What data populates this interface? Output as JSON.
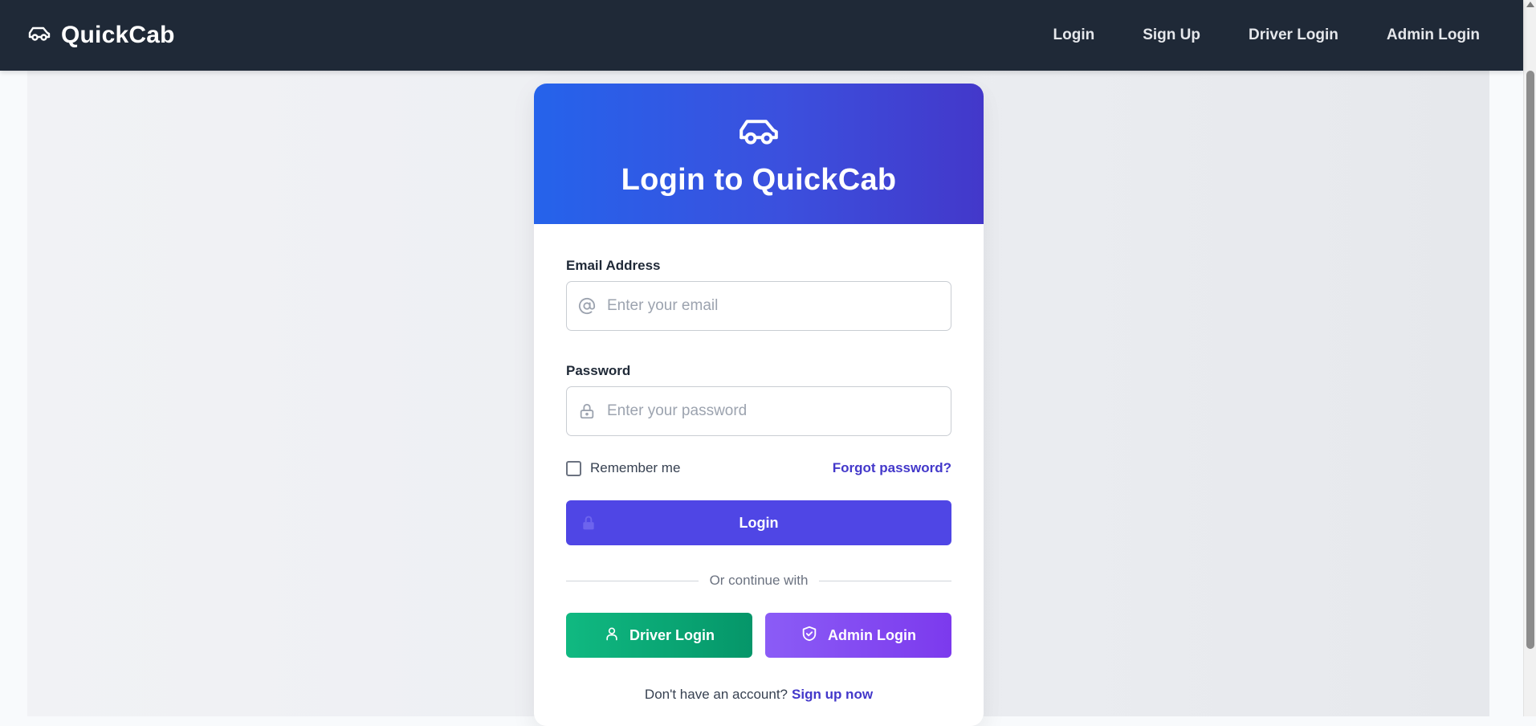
{
  "navbar": {
    "brand": "QuickCab",
    "brand_icon": "car-icon",
    "links": [
      {
        "label": "Login"
      },
      {
        "label": "Sign Up"
      },
      {
        "label": "Driver Login"
      },
      {
        "label": "Admin Login"
      }
    ]
  },
  "card": {
    "header_icon": "car-icon",
    "title": "Login to QuickCab",
    "email": {
      "label": "Email Address",
      "placeholder": "Enter your email",
      "value": "",
      "icon": "at-icon"
    },
    "password": {
      "label": "Password",
      "placeholder": "Enter your password",
      "value": "",
      "icon": "lock-icon"
    },
    "remember_label": "Remember me",
    "remember_checked": false,
    "forgot_label": "Forgot password?",
    "login_button": "Login",
    "divider_text": "Or continue with",
    "driver_button": "Driver Login",
    "admin_button": "Admin Login",
    "signup_prompt": "Don't have an account?",
    "signup_link": "Sign up now"
  },
  "colors": {
    "navbar_bg": "#1f2937",
    "header_gradient_start": "#2563eb",
    "header_gradient_end": "#4338ca",
    "primary": "#4f46e5",
    "link": "#4338ca",
    "driver_green": "#10b981",
    "admin_purple": "#8b5cf6"
  }
}
